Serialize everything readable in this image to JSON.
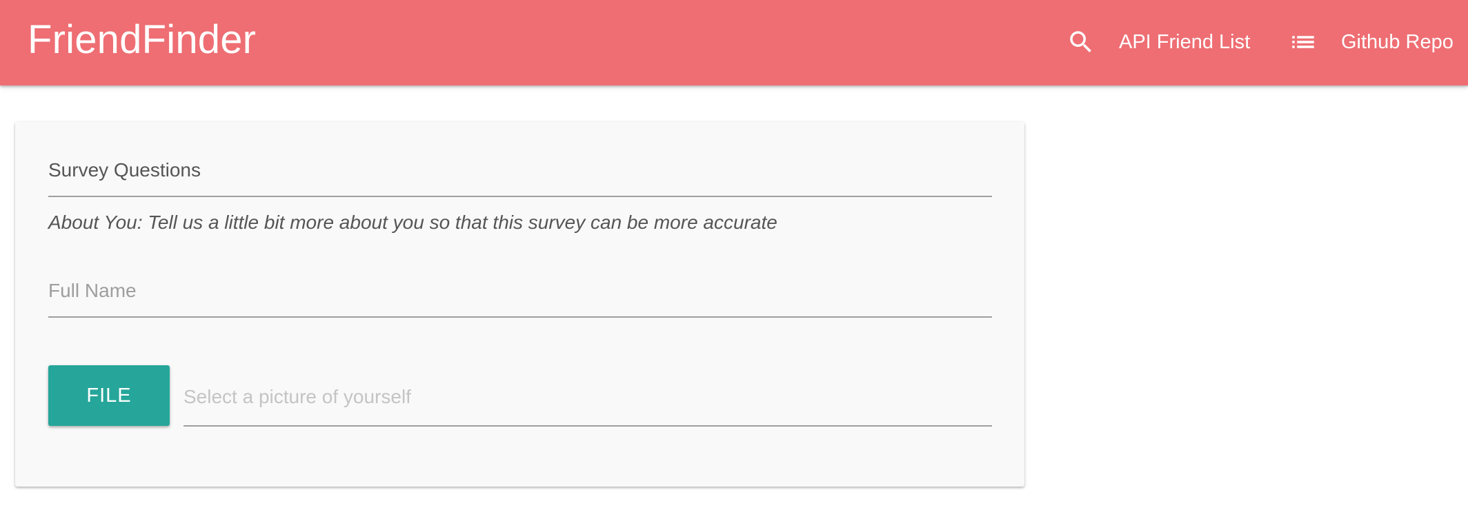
{
  "navbar": {
    "brand": "FriendFinder",
    "links": [
      {
        "label": "API Friend List",
        "icon": "search-icon"
      },
      {
        "label": "Github Repo",
        "icon": "list-icon"
      }
    ],
    "color": "#ee6e73"
  },
  "survey": {
    "title": "Survey Questions",
    "about": "About You: Tell us a little bit more about you so that this survey can be more accurate",
    "full_name": {
      "placeholder": "Full Name",
      "value": ""
    },
    "file_button_label": "FILE",
    "file_path": {
      "placeholder": "Select a picture of yourself",
      "value": ""
    },
    "button_color": "#26a69a"
  }
}
